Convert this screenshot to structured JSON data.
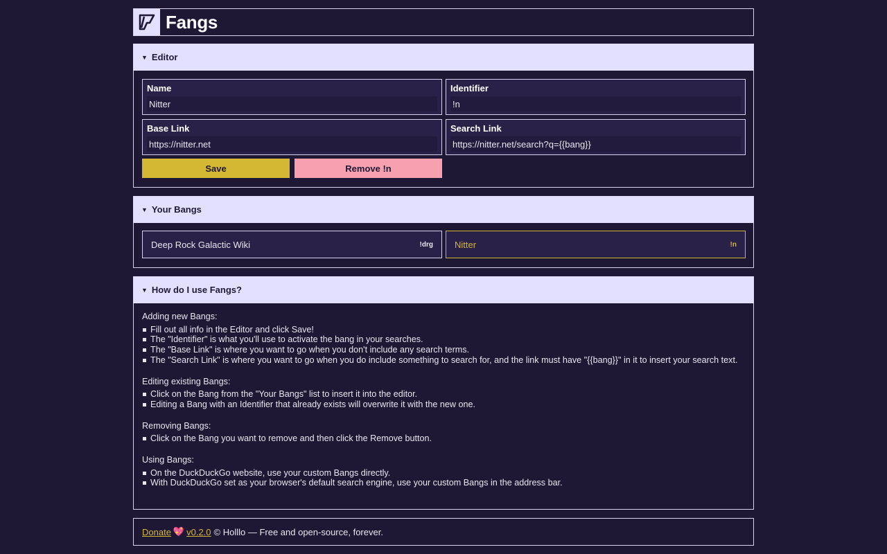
{
  "header": {
    "title": "Fangs"
  },
  "editor": {
    "heading": "Editor",
    "fields": [
      {
        "label": "Name",
        "value": "Nitter"
      },
      {
        "label": "Identifier",
        "value": "!n"
      },
      {
        "label": "Base Link",
        "value": "https://nitter.net"
      },
      {
        "label": "Search Link",
        "value": "https://nitter.net/search?q={{bang}}"
      }
    ],
    "save_label": "Save",
    "remove_label": "Remove !n"
  },
  "bangs": {
    "heading": "Your Bangs",
    "items": [
      {
        "name": "Deep Rock Galactic Wiki",
        "id": "!drg"
      },
      {
        "name": "Nitter",
        "id": "!n"
      }
    ]
  },
  "howto": {
    "heading": "How do I use Fangs?",
    "sections": [
      {
        "title": "Adding new Bangs:",
        "items": [
          "Fill out all info in the Editor and click Save!",
          "The \"Identifier\" is what you'll use to activate the bang in your searches.",
          "The \"Base Link\" is where you want to go when you don't include any search terms.",
          "The \"Search Link\" is where you want to go when you do include something to search for, and the link must have \"{{bang}}\" in it to insert your search text."
        ]
      },
      {
        "title": "Editing existing Bangs:",
        "items": [
          "Click on the Bang from the \"Your Bangs\" list to insert it into the editor.",
          "Editing a Bang with an Identifier that already exists will overwrite it with the new one."
        ]
      },
      {
        "title": "Removing Bangs:",
        "items": [
          "Click on the Bang you want to remove and then click the Remove button."
        ]
      },
      {
        "title": "Using Bangs:",
        "items": [
          "On the DuckDuckGo website, use your custom Bangs directly.",
          "With DuckDuckGo set as your browser's default search engine, use your custom Bangs in the address bar."
        ]
      }
    ]
  },
  "footer": {
    "donate": "Donate",
    "heart": "💖",
    "version": "v0.2.0",
    "rest": "© Holllo — Free and open-source, forever."
  },
  "colors": {
    "bg": "#1e1834",
    "header": "#e3e0ff",
    "save": "#d4b733",
    "remove": "#f7a0b0",
    "accent": "#d4b733"
  }
}
